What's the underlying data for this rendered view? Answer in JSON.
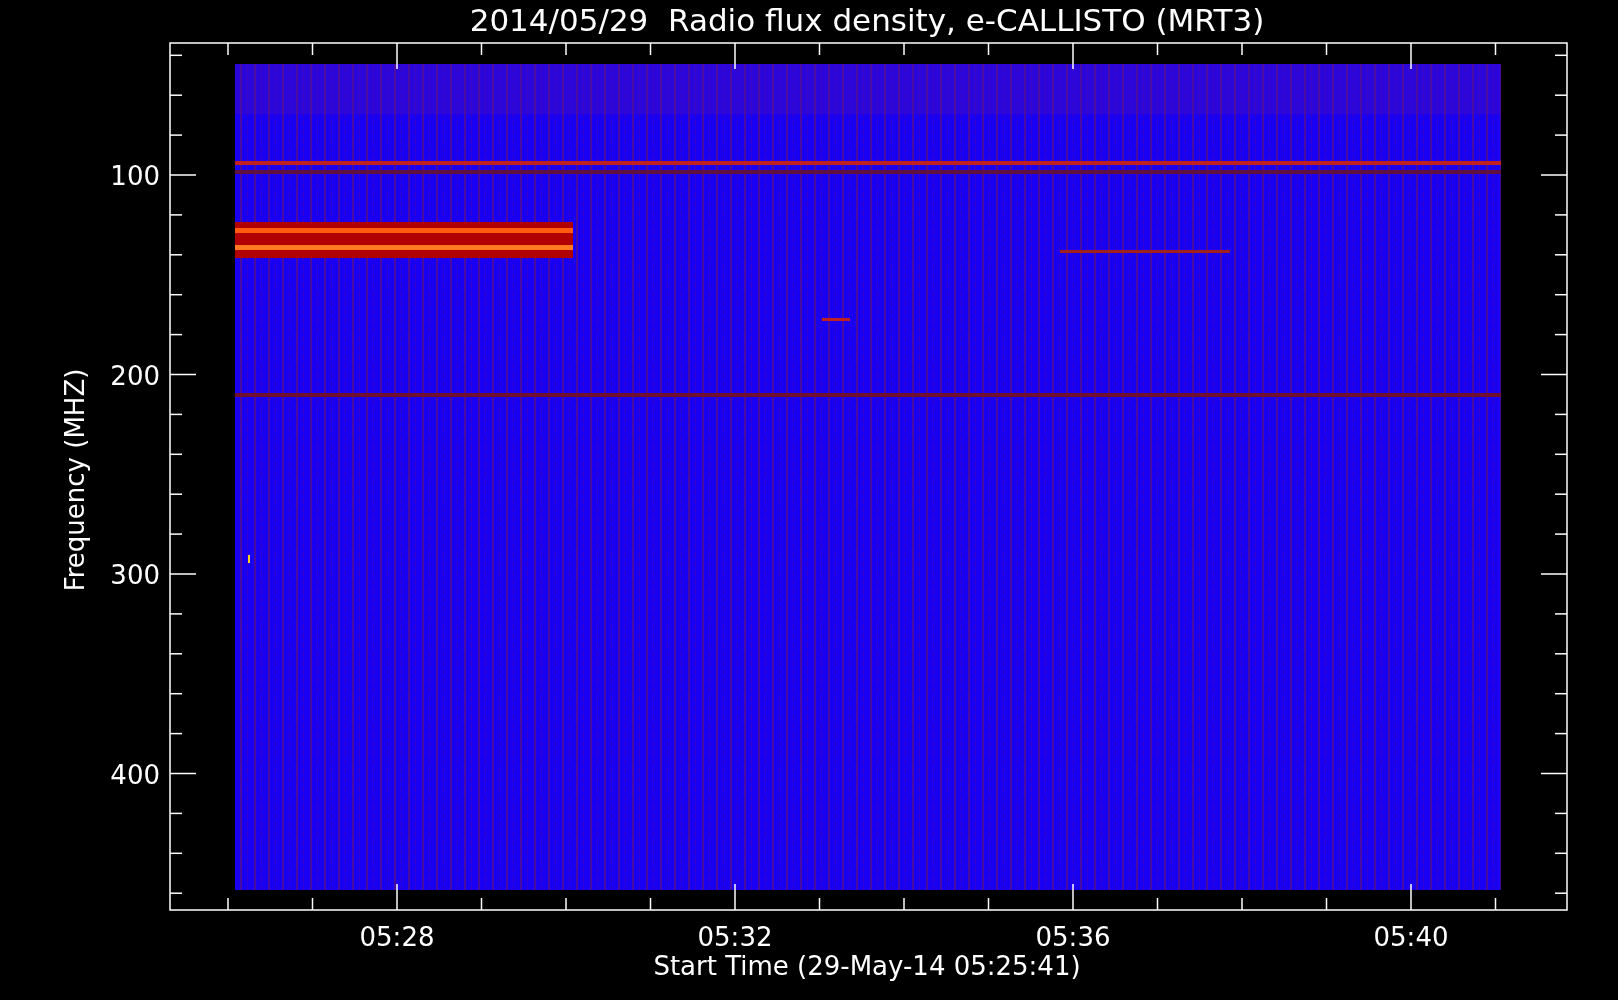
{
  "title": "2014/05/29  Radio flux density, e-CALLISTO (MRT3)",
  "plot": {
    "ylabel": "Frequency (MHZ)",
    "xlabel": "Start Time (29-May-14 05:25:41)",
    "yticks": [
      "100",
      "200",
      "300",
      "400"
    ],
    "xticks": [
      "05:28",
      "05:32",
      "05:36",
      "05:40"
    ]
  }
}
